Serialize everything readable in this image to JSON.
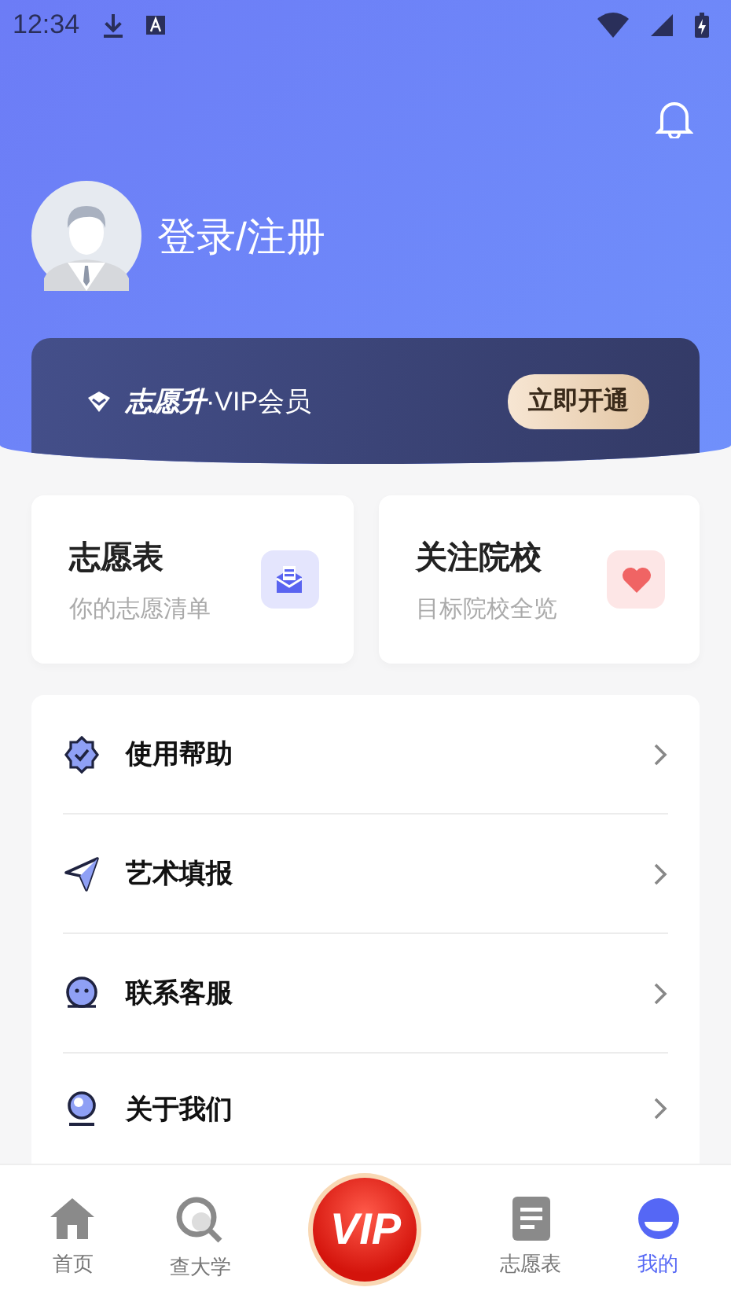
{
  "status_bar": {
    "time": "12:34"
  },
  "profile": {
    "name": "登录/注册"
  },
  "vip_banner": {
    "brand": "志愿升",
    "label": "·VIP会员",
    "button": "立即开通"
  },
  "shortcuts": [
    {
      "title": "志愿表",
      "subtitle": "你的志愿清单",
      "kind": "list"
    },
    {
      "title": "关注院校",
      "subtitle": "目标院校全览",
      "kind": "heart"
    }
  ],
  "menu": [
    {
      "label": "使用帮助",
      "kind": "help"
    },
    {
      "label": "艺术填报",
      "kind": "send"
    },
    {
      "label": "联系客服",
      "kind": "chat"
    },
    {
      "label": "关于我们",
      "kind": "about"
    }
  ],
  "tab_bar": [
    {
      "label": "首页",
      "kind": "home",
      "selected": false
    },
    {
      "label": "查大学",
      "kind": "search",
      "selected": false
    },
    {
      "label": "VIP",
      "kind": "vip",
      "selected": false
    },
    {
      "label": "志愿表",
      "kind": "list",
      "selected": false
    },
    {
      "label": "我的",
      "kind": "me",
      "selected": true
    }
  ]
}
